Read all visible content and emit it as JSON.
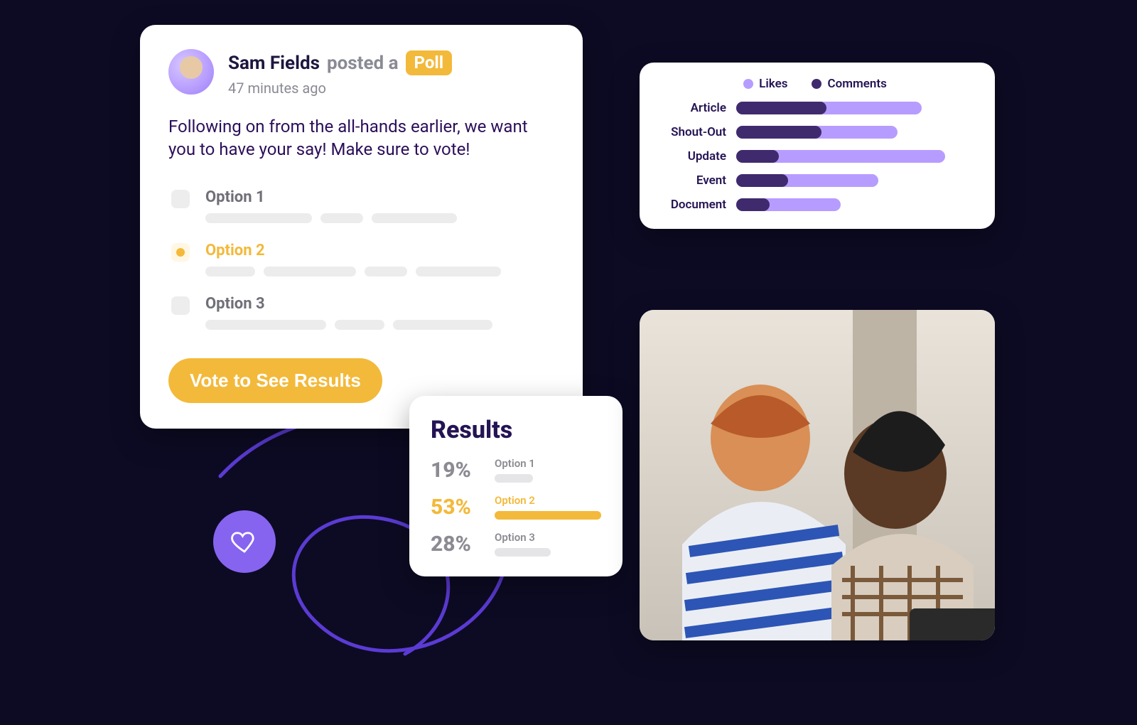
{
  "colors": {
    "accent_yellow": "#f3b93a",
    "accent_purple_light": "#b79cff",
    "accent_purple_dark": "#3f2a6e",
    "background": "#0d0b24"
  },
  "poll": {
    "author": "Sam Fields",
    "action_text": "posted a",
    "badge": "Poll",
    "time": "47 minutes ago",
    "body": "Following on from the all-hands earlier, we want you to have your say! Make sure to vote!",
    "options": [
      {
        "label": "Option 1",
        "selected": false
      },
      {
        "label": "Option 2",
        "selected": true
      },
      {
        "label": "Option 3",
        "selected": false
      }
    ],
    "vote_button": "Vote to See Results"
  },
  "results": {
    "title": "Results",
    "rows": [
      {
        "pct_label": "19%",
        "pct": 19,
        "label": "Option 1",
        "winner": false
      },
      {
        "pct_label": "53%",
        "pct": 53,
        "label": "Option 2",
        "winner": true
      },
      {
        "pct_label": "28%",
        "pct": 28,
        "label": "Option 3",
        "winner": false
      }
    ]
  },
  "chart": {
    "legend": {
      "likes": "Likes",
      "comments": "Comments"
    }
  },
  "chart_data": {
    "type": "bar",
    "orientation": "horizontal",
    "stacked": true,
    "title": "",
    "categories": [
      "Article",
      "Shout-Out",
      "Update",
      "Event",
      "Document"
    ],
    "series": [
      {
        "name": "Comments",
        "color": "#3f2a6e",
        "values": [
          38,
          36,
          18,
          22,
          14
        ]
      },
      {
        "name": "Likes",
        "color": "#b79cff",
        "values": [
          40,
          32,
          70,
          38,
          30
        ]
      }
    ],
    "xlim": [
      0,
      100
    ]
  }
}
